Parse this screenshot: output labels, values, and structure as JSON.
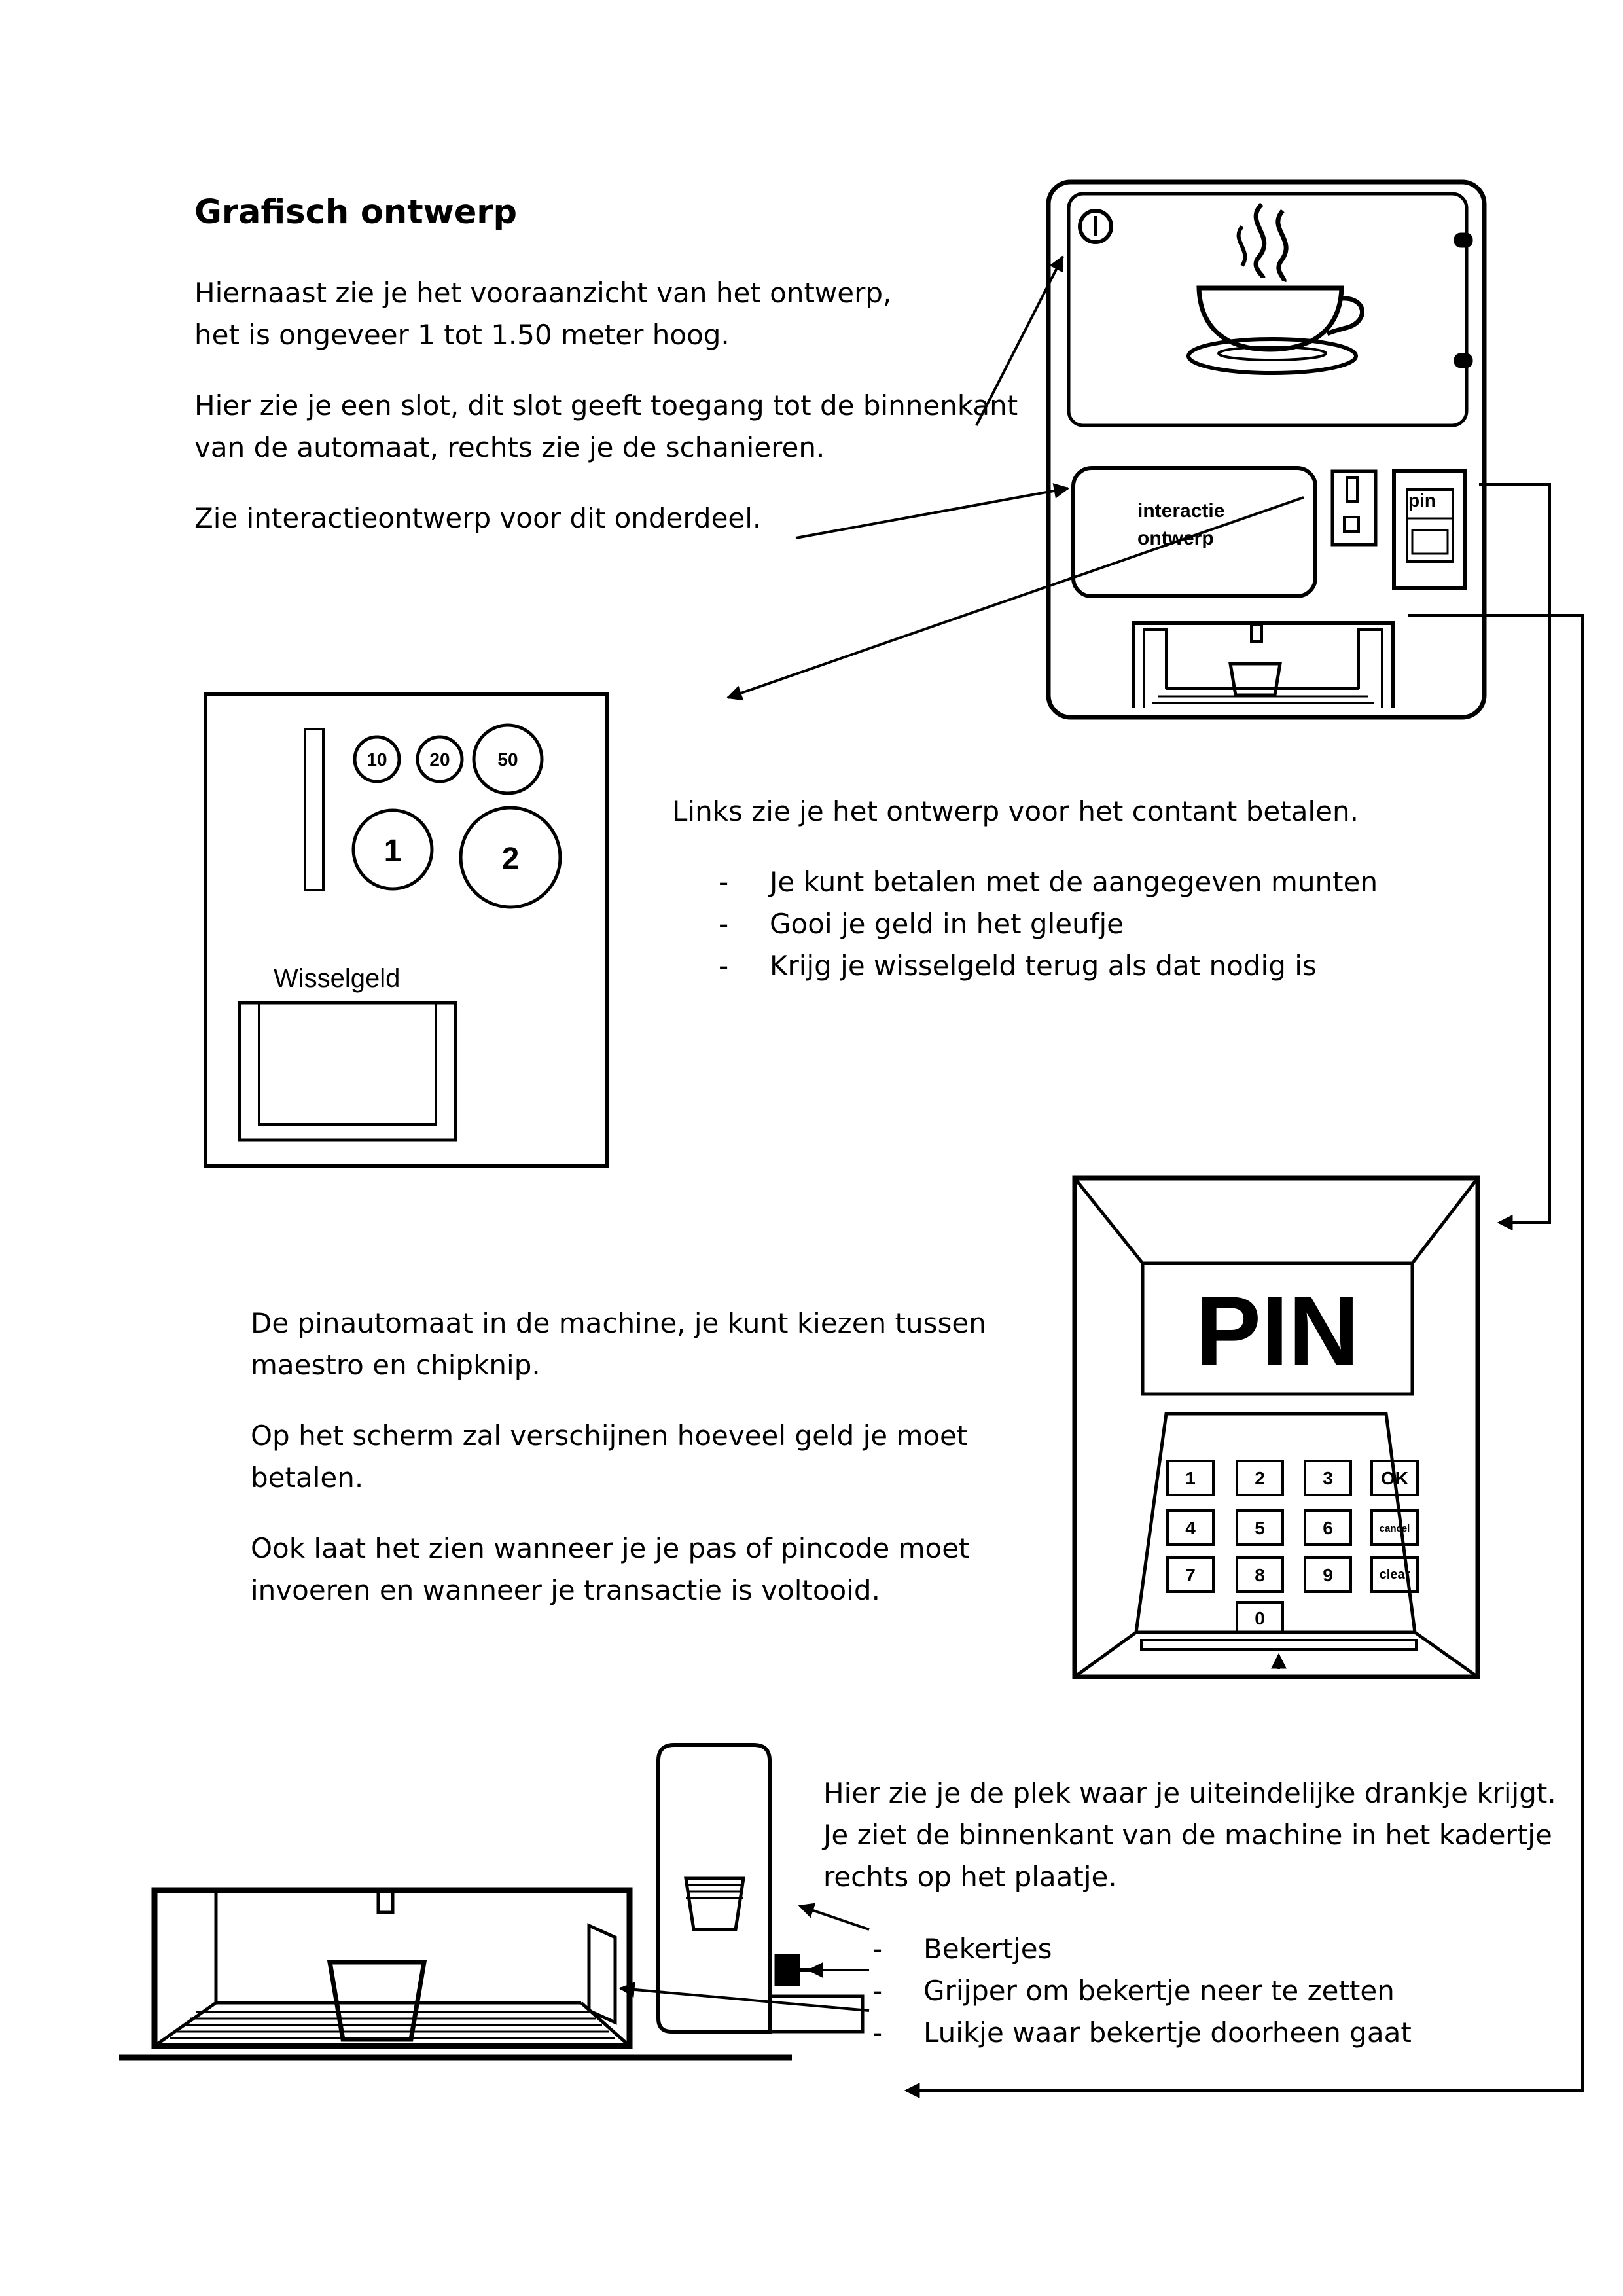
{
  "page": {
    "title": "Grafisch ontwerp",
    "intro_lines": [
      "Hiernaast zie je het vooraanzicht van het ontwerp,",
      "het is ongeveer 1 tot 1.50 meter hoog."
    ],
    "slot_lines": [
      "Hier zie je een slot, dit slot geeft toegang tot de binnenkant",
      "van de automaat, rechts zie je de schanieren."
    ],
    "interaction_line": "Zie interactieontwerp voor dit onderdeel.",
    "cash_intro": "Links zie je het ontwerp voor het contant betalen.",
    "cash_bullets": [
      "Je kunt betalen met de aangegeven munten",
      "Gooi je geld in het gleufje",
      "Krijg je wisselgeld terug als dat nodig is"
    ],
    "pin_paragraphs": [
      [
        "De pinautomaat in de machine, je kunt kiezen tussen",
        "maestro en chipknip."
      ],
      [
        "Op het scherm zal verschijnen hoeveel geld je moet",
        "betalen."
      ],
      [
        "Ook laat het zien wanneer je je pas of pincode moet",
        "invoeren en wanneer je transactie is voltooid."
      ]
    ],
    "delivery_lines": [
      "Hier zie je de plek waar je uiteindelijke drankje krijgt.",
      "Je ziet de binnenkant van de machine in het kadertje",
      "rechts op het plaatje."
    ],
    "delivery_bullets": [
      "Bekertjes",
      "Grijper om bekertje neer te zetten",
      "Luikje waar bekertje doorheen gaat"
    ],
    "bullet_dash": "-"
  },
  "machine": {
    "panel_label_line1": "interactie",
    "panel_label_line2": "ontwerp",
    "pin_slot_label": "pin"
  },
  "cash_panel": {
    "coins_small": [
      "10",
      "20",
      "50"
    ],
    "coins_large": [
      "1",
      "2"
    ],
    "change_label": "Wisselgeld"
  },
  "pin_terminal": {
    "screen_text": "PIN",
    "keys_row1": [
      "1",
      "2",
      "3",
      "OK"
    ],
    "keys_row2": [
      "4",
      "5",
      "6",
      "cancel"
    ],
    "keys_row3": [
      "7",
      "8",
      "9",
      "clear"
    ],
    "key_zero": "0"
  }
}
